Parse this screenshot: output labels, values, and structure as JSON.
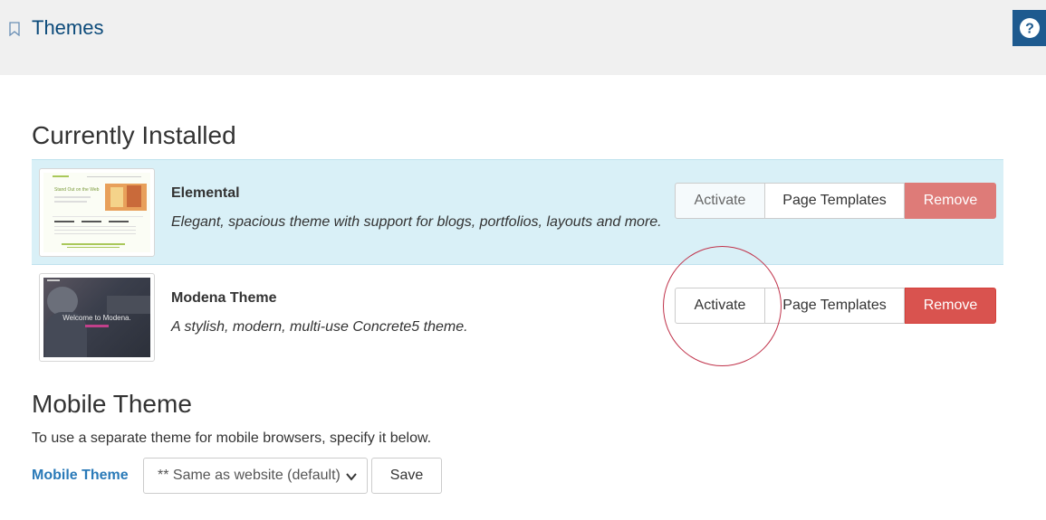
{
  "header": {
    "title": "Themes",
    "help_icon": "question-circle-icon"
  },
  "installed": {
    "heading": "Currently Installed",
    "themes": [
      {
        "name": "Elemental",
        "description": "Elegant, spacious theme with support for blogs, portfolios, layouts and more.",
        "activate_label": "Activate",
        "templates_label": "Page Templates",
        "remove_label": "Remove",
        "is_active": true,
        "thumbnail_text": "Stand Out on the Web"
      },
      {
        "name": "Modena Theme",
        "description": "A stylish, modern, multi-use Concrete5 theme.",
        "activate_label": "Activate",
        "templates_label": "Page Templates",
        "remove_label": "Remove",
        "is_active": false,
        "thumbnail_text": "Welcome to Modena."
      }
    ]
  },
  "mobile": {
    "heading": "Mobile Theme",
    "description": "To use a separate theme for mobile browsers, specify it below.",
    "label": "Mobile Theme",
    "selected": "** Same as website (default)",
    "save_label": "Save"
  },
  "colors": {
    "accent": "#2a7ab8",
    "remove": "#d9534f",
    "active_row": "#d9f0f7",
    "annotation": "#c0324a"
  }
}
